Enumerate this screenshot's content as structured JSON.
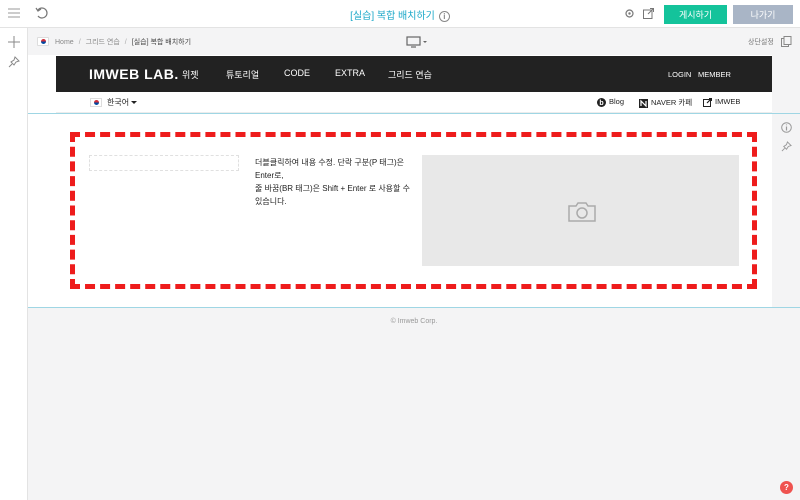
{
  "toolbar": {
    "title": "[실습] 복합 배치하기",
    "publish_label": "게시하기",
    "exit_label": "나가기"
  },
  "subbar": {
    "breadcrumbs": [
      "Home",
      "그리드 연습",
      "[실습] 복합 배치하기"
    ],
    "top_setting_label": "상단설정"
  },
  "site": {
    "logo": "IMWEB LAB.",
    "nav": [
      "위젯",
      "튜토리얼",
      "CODE",
      "EXTRA",
      "그리드 연습"
    ],
    "login": "LOGIN",
    "member": "MEMBER",
    "language": "한국어",
    "links": [
      "Blog",
      "NAVER 카페",
      "IMWEB"
    ]
  },
  "section": {
    "text_lines": [
      "더블클릭하여 내용 수정. 단락 구분(P 태그)은 Enter로,",
      "줄 바꿈(BR 태그)은 Shift + Enter 로 사용할 수 있습니다."
    ]
  },
  "footer": {
    "copyright": "© Imweb Corp."
  },
  "help": {
    "label": "?"
  },
  "colors": {
    "accent": "#14c39b",
    "title": "#1aa7c8",
    "frame": "#ee1c1c",
    "nav_bg": "#222222"
  }
}
